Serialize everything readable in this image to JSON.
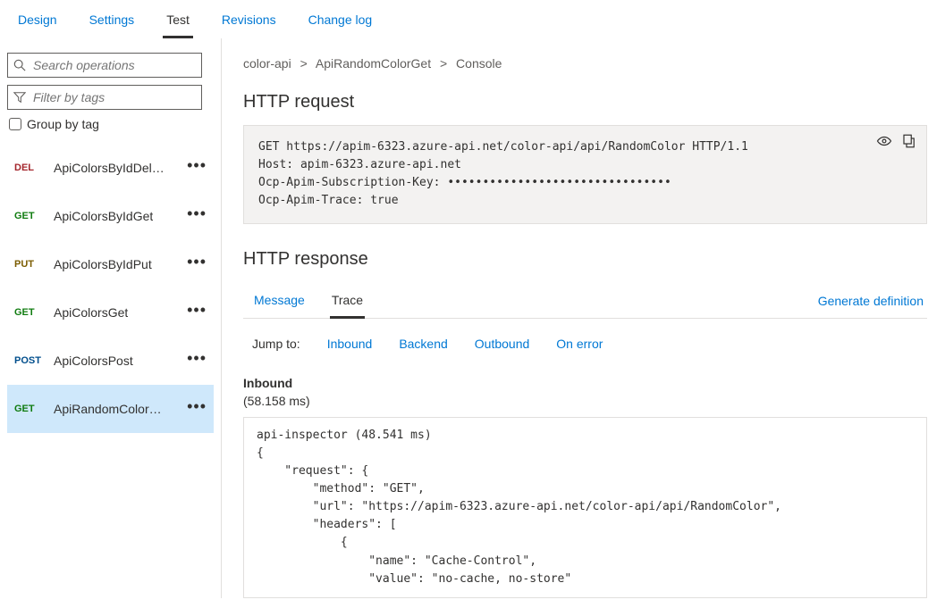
{
  "topnav": {
    "items": [
      {
        "label": "Design",
        "active": false
      },
      {
        "label": "Settings",
        "active": false
      },
      {
        "label": "Test",
        "active": true
      },
      {
        "label": "Revisions",
        "active": false
      },
      {
        "label": "Change log",
        "active": false
      }
    ]
  },
  "sidebar": {
    "search_placeholder": "Search operations",
    "filter_placeholder": "Filter by tags",
    "group_by_label": "Group by tag",
    "operations": [
      {
        "method": "DEL",
        "method_class": "m-del",
        "name": "ApiColorsByIdDel…",
        "selected": false
      },
      {
        "method": "GET",
        "method_class": "m-get",
        "name": "ApiColorsByIdGet",
        "selected": false
      },
      {
        "method": "PUT",
        "method_class": "m-put",
        "name": "ApiColorsByIdPut",
        "selected": false
      },
      {
        "method": "GET",
        "method_class": "m-get",
        "name": "ApiColorsGet",
        "selected": false
      },
      {
        "method": "POST",
        "method_class": "m-post",
        "name": "ApiColorsPost",
        "selected": false
      },
      {
        "method": "GET",
        "method_class": "m-get",
        "name": "ApiRandomColor…",
        "selected": true
      }
    ]
  },
  "breadcrumbs": {
    "api": "color-api",
    "operation": "ApiRandomColorGet",
    "page": "Console",
    "sep": ">"
  },
  "request": {
    "heading": "HTTP request",
    "raw": "GET https://apim-6323.azure-api.net/color-api/api/RandomColor HTTP/1.1\nHost: apim-6323.azure-api.net\nOcp-Apim-Subscription-Key: ••••••••••••••••••••••••••••••••\nOcp-Apim-Trace: true"
  },
  "response": {
    "heading": "HTTP response",
    "tabs": [
      {
        "label": "Message",
        "active": false
      },
      {
        "label": "Trace",
        "active": true
      }
    ],
    "generate_label": "Generate definition",
    "jump": {
      "label": "Jump to:",
      "links": [
        "Inbound",
        "Backend",
        "Outbound",
        "On error"
      ]
    },
    "inbound": {
      "title": "Inbound",
      "time": "(58.158 ms)",
      "trace": "api-inspector (48.541 ms)\n{\n    \"request\": {\n        \"method\": \"GET\",\n        \"url\": \"https://apim-6323.azure-api.net/color-api/api/RandomColor\",\n        \"headers\": [\n            {\n                \"name\": \"Cache-Control\",\n                \"value\": \"no-cache, no-store\""
    }
  }
}
